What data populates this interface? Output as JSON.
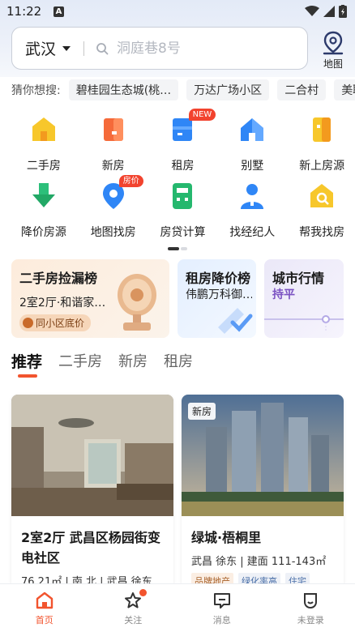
{
  "status": {
    "time": "11:22",
    "notif": "A"
  },
  "search": {
    "city": "武汉",
    "placeholder": "洞庭巷8号"
  },
  "map_button": {
    "label": "地图"
  },
  "hot": {
    "title": "猜你想搜:",
    "chips": [
      "碧桂园生态城(桃…",
      "万达广场小区",
      "二合村",
      "美联"
    ]
  },
  "grid": {
    "row1": [
      {
        "label": "二手房",
        "icon": "secondhand-house-icon"
      },
      {
        "label": "新房",
        "icon": "new-house-icon"
      },
      {
        "label": "租房",
        "icon": "rent-icon",
        "badge": "NEW"
      },
      {
        "label": "别墅",
        "icon": "villa-icon"
      },
      {
        "label": "新上房源",
        "icon": "new-listing-icon"
      }
    ],
    "row2": [
      {
        "label": "降价房源",
        "icon": "price-drop-icon"
      },
      {
        "label": "地图找房",
        "icon": "map-search-icon",
        "badge": "房价"
      },
      {
        "label": "房贷计算",
        "icon": "calculator-icon"
      },
      {
        "label": "找经纪人",
        "icon": "agent-icon"
      },
      {
        "label": "帮我找房",
        "icon": "help-find-icon"
      }
    ]
  },
  "promos": {
    "card1": {
      "title": "二手房捡漏榜",
      "sub": "2室2厅·和谐家…",
      "tag": "同小区底价"
    },
    "card2": {
      "title": "租房降价榜",
      "sub": "伟鹏万科御…"
    },
    "card3": {
      "title": "城市行情",
      "sub": "持平"
    }
  },
  "tabs": [
    "推荐",
    "二手房",
    "新房",
    "租房"
  ],
  "listings": [
    {
      "title": "2室2厅 武昌区杨园街变电社区",
      "meta": "76.21㎡ | 南 北 | 武昌 徐东"
    },
    {
      "tag": "新房",
      "title": "绿城·梧桐里",
      "meta": "武昌 徐东 | 建面 111-143㎡",
      "chips": [
        "品牌地产",
        "绿化率高",
        "住宅"
      ]
    }
  ],
  "nav": [
    {
      "label": "首页",
      "icon": "home-icon",
      "active": true
    },
    {
      "label": "关注",
      "icon": "star-icon"
    },
    {
      "label": "消息",
      "icon": "message-icon"
    },
    {
      "label": "未登录",
      "icon": "user-icon"
    }
  ],
  "colors": {
    "accent": "#f2542e",
    "blue": "#1e88e5",
    "orange": "#f5a623"
  }
}
